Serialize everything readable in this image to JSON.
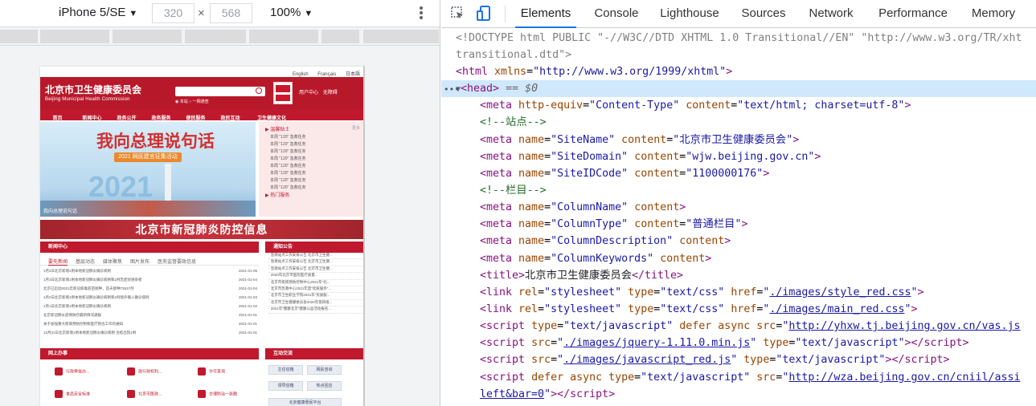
{
  "device_toolbar": {
    "device": "iPhone 5/SE",
    "width": "320",
    "height": "568",
    "zoom": "100%"
  },
  "site": {
    "languages": [
      "English",
      "Français",
      "日本語"
    ],
    "name_cn": "北京市卫生健康委员会",
    "name_en": "Beijing Municipal Health Commission",
    "search_opts": [
      "◉ 本站",
      "○ 一网通查"
    ],
    "account": [
      "用户中心",
      "无障碍"
    ],
    "nav": [
      "首页",
      "新闻中心",
      "政务公开",
      "政务服务",
      "便民服务",
      "政民互动",
      "卫生健康文化"
    ],
    "banner_title": "我向总理说句话",
    "banner_pill": "2021 网民建言征集活动",
    "banner_year": "2021",
    "banner_caption": "我向总理说句话",
    "hint": {
      "title": "▶ 温馨贴士",
      "more": "更多",
      "items": [
        "本周 \"120\" 急救任务",
        "本周 \"120\" 急救任务",
        "本周 \"120\" 急救任务",
        "本周 \"120\" 急救任务",
        "本周 \"120\" 急救任务",
        "本周 \"120\" 急救任务",
        "本周 \"120\" 急救任务",
        "本周 \"120\" 急救任务"
      ],
      "hot": "▶ 热门服务"
    },
    "covid_banner": "北京市新冠肺炎防控信息",
    "news": {
      "title": "新闻中心",
      "more": "更多>>",
      "tabs": [
        "要先新闻",
        "基层动态",
        "媒体聚焦",
        "图片发布",
        "医务监督要政信息"
      ],
      "items": [
        {
          "t": "1月4日北京新增1例本地新冠肺炎确诊病例",
          "d": "2021-01-05"
        },
        {
          "t": "1月3日北京新增1例本地新冠肺炎确诊病例和1例无症状感染者",
          "d": "2021-01-04"
        },
        {
          "t": "北京已启动2021年新冠病毒疫苗接种，首天接种73537剂",
          "d": "2021-01-04"
        },
        {
          "t": "1月2日北京新增1例本地新冠肺炎确诊病例和1例境外输入确诊病例",
          "d": "2021-01-03"
        },
        {
          "t": "1月1日北京新增1例本地新冠肺炎确诊病例",
          "d": "2021-01-02"
        },
        {
          "t": "北京新冠肺炎疫情防控最新情况通报",
          "d": "2021-01-01"
        },
        {
          "t": "关于加强重大疾病预防控制和医疗救治工作的通知",
          "d": "2021-01-01"
        },
        {
          "t": "12月31日北京新增1例本地新冠肺炎确诊病例 治愈出院1例",
          "d": "2021-01-01"
        }
      ]
    },
    "notice": {
      "title": "通知公告",
      "items": [
        "· 急救站点工作安排公告 北京市卫生健...",
        "· 急救站点工作安排公告 北京市卫生健...",
        "· 急救站点工作安排公告 北京市卫生健...",
        "· 2020年北京市医院医疗质量...",
        "· 北京市疾病预防控制中心2021年“北...",
        "· 北京市急救中心2021年度“优质服务”...",
        "· 北京市卫生职业学院2021年“优质服...",
        "· 北京市卫生健康委员会2020年第四批...",
        "· 2021年“健康北京”健康公益活动报名..."
      ]
    },
    "services": {
      "title": "网上办事",
      "more": "更多>>",
      "items": [
        "行政审批办...",
        "政行政权利...",
        "许可查询",
        "食品安全标准",
        "北京市医政...",
        "合理防治一张图"
      ]
    },
    "interact": {
      "title": "互动交流",
      "items": [
        "主任信箱",
        "网民咨询",
        "领导信箱",
        "热点回应",
        "北京健康惠民平台"
      ]
    }
  },
  "devtools": {
    "tabs": [
      "Elements",
      "Console",
      "Lighthouse",
      "Sources",
      "Network",
      "Performance",
      "Memory"
    ],
    "active_tab": "Elements",
    "selected_suffix": "== $0",
    "lines": {
      "doctype_1": "<!DOCTYPE html PUBLIC \"-//W3C//DTD XHTML 1.0 Transitional//EN\" \"http://www.w3.org/TR/xht",
      "doctype_2": "transitional.dtd\">",
      "html_tag": "<html",
      "html_attr": "xmlns",
      "html_val": "\"http://www.w3.org/1999/xhtml\"",
      "head_tag": "<head>",
      "meta_http_equiv": "\"Content-Type\"",
      "meta_content": "\"text/html; charset=utf-8\"",
      "comment_site": "<!--站点-->",
      "site_name_name": "\"SiteName\"",
      "site_name_content": "\"北京市卫生健康委员会\"",
      "site_domain_name": "\"SiteDomain\"",
      "site_domain_content": "\"wjw.beijing.gov.cn\"",
      "site_id_name": "\"SiteIDCode\"",
      "site_id_content": "\"1100000176\"",
      "comment_column": "<!--栏目-->",
      "col_name": "\"ColumnName\"",
      "col_type_name": "\"ColumnType\"",
      "col_type_content": "\"普通栏目\"",
      "col_desc_name": "\"ColumnDescription\"",
      "col_kw_name": "\"ColumnKeywords\"",
      "title_text": "北京市卫生健康委员会",
      "css_style": "./images/style_red.css",
      "css_main": "./images/main_red.css",
      "script_vas": "http://yhxw.tj.beijing.gov.cn/vas.js",
      "script_jquery": "./images/jquery-1.11.0.min.js",
      "script_red": "./images/javascript_red.js",
      "script_wza_1": "http://wza.beijing.gov.cn/cniil/assi",
      "script_wza_2": "left&bar=0"
    }
  }
}
